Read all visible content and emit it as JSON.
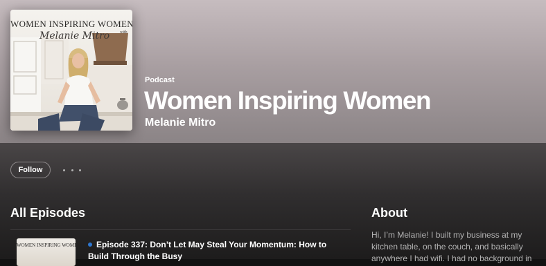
{
  "show": {
    "eyebrow": "Podcast",
    "title": "Women Inspiring Women",
    "host": "Melanie Mitro"
  },
  "cover": {
    "title": "WOMEN INSPIRING WOMEN",
    "host_script": "Melanie Mitro",
    "with": "with"
  },
  "actions": {
    "follow_label": "Follow"
  },
  "episodes": {
    "heading": "All Episodes",
    "items": [
      {
        "thumb_text": "WOMEN INSPIRING WOMEN",
        "title": "Episode 337: Don’t Let May Steal Your Momentum: How to Build Through the Busy",
        "unplayed": true
      }
    ]
  },
  "about": {
    "heading": "About",
    "text": "Hi, I’m Melanie! I built my business at my kitchen table, on the couch, and basically anywhere I had wifi. I had no background in"
  },
  "colors": {
    "hero_top": "#c6bcbf",
    "hero_bottom": "#8b8486",
    "unplayed_dot": "#2e77d0",
    "muted_text": "#b3b3b3"
  }
}
